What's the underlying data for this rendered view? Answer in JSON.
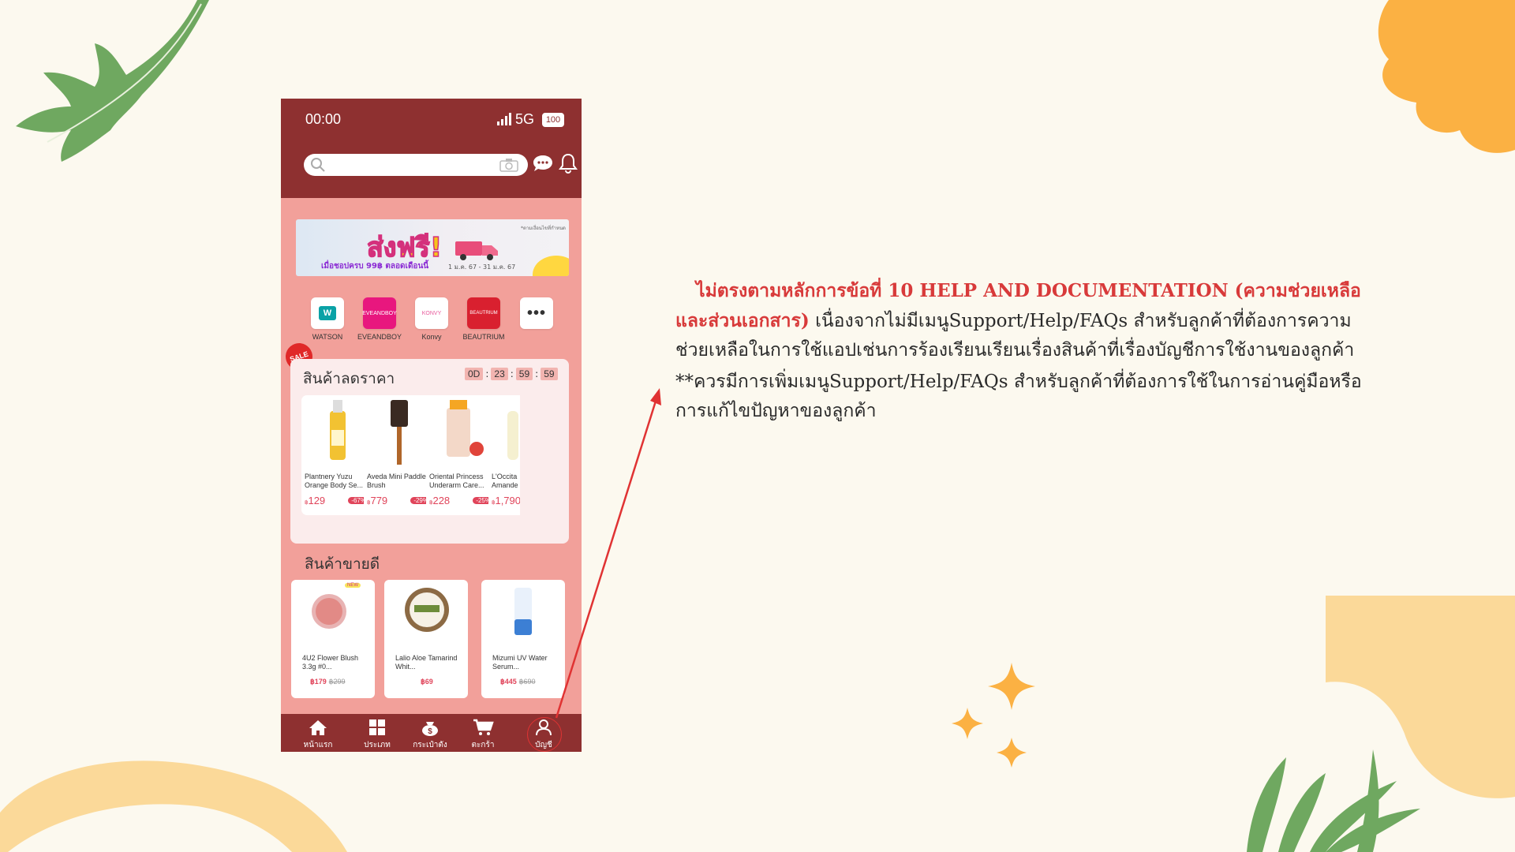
{
  "phone": {
    "status": {
      "time": "00:00",
      "network": "5G",
      "battery": "100"
    },
    "banner": {
      "title": "ส่งฟรี!",
      "subtitle": "เมื่อชอปครบ 99฿ ตลอดเดือนนี้",
      "date_range": "1 ม.ค. 67 - 31 ม.ค. 67"
    },
    "shops": [
      {
        "label": "WATSON",
        "icon_text": "W"
      },
      {
        "label": "EVEANDBOY",
        "icon_text": "EVEANDBOY"
      },
      {
        "label": "Konvy",
        "icon_text": "KONVY"
      },
      {
        "label": "BEAUTRIUM",
        "icon_text": "BEAUTRIUM"
      }
    ],
    "flash_sale": {
      "badge": "SALE",
      "heading": "สินค้าลดราคา",
      "timer": [
        "0D",
        "23",
        "59",
        "59"
      ],
      "products": [
        {
          "name": "Plantnery Yuzu Orange Body Se...",
          "price": "129",
          "discount": "-67%"
        },
        {
          "name": "Aveda Mini Paddle Brush",
          "price": "779",
          "discount": "-29%"
        },
        {
          "name": "Oriental Princess Underarm Care...",
          "price": "228",
          "discount": "-25%"
        },
        {
          "name": "L'Occita Amande",
          "price": "1,790",
          "discount": ""
        }
      ]
    },
    "best_sellers": {
      "heading": "สินค้าขายดี",
      "products": [
        {
          "name": "4U2 Flower Blush 3.3g #0...",
          "price": "฿179",
          "old_price": "฿299",
          "tag": "NEW"
        },
        {
          "name": "Lalio Aloe Tamarind Whit...",
          "price": "฿69",
          "old_price": "",
          "tag": ""
        },
        {
          "name": "Mizumi UV Water Serum...",
          "price": "฿445",
          "old_price": "฿690",
          "tag": ""
        }
      ]
    },
    "tabbar": [
      {
        "label": "หน้าแรก",
        "icon": "home-icon"
      },
      {
        "label": "ประเภท",
        "icon": "grid-icon"
      },
      {
        "label": "กระเป๋าตัง",
        "icon": "wallet-icon"
      },
      {
        "label": "ตะกร้า",
        "icon": "cart-icon"
      },
      {
        "label": "บัญชี",
        "icon": "user-icon"
      }
    ]
  },
  "annotation": {
    "heading": "ไม่ตรงตามหลักการข้อที่ 10 HELP AND DOCUMENTATION (ความช่วยเหลือและส่วนเอกสาร)",
    "body": "เนื่องจากไม่มีเมนูSupport/Help/FAQs สำหรับลูกค้าที่ต้องการความช่วยเหลือในการใช้แอปเช่นการร้องเรียนเรียนเรื่องสินค้าที่เรื่องบัญชีการใช้งานของลูกค้า",
    "recommendation": "**ควรมีการเพิ่มเมนูSupport/Help/FAQs สำหรับลูกค้าที่ต้องการใช้ในการอ่านคู่มือหรือการแก้ไขปัญหาของลูกค้า"
  },
  "colors": {
    "header": "#8e3030",
    "phone_bg": "#f2a09a",
    "annotation_red": "#d83a3a",
    "page_bg": "#fcf9ef"
  }
}
